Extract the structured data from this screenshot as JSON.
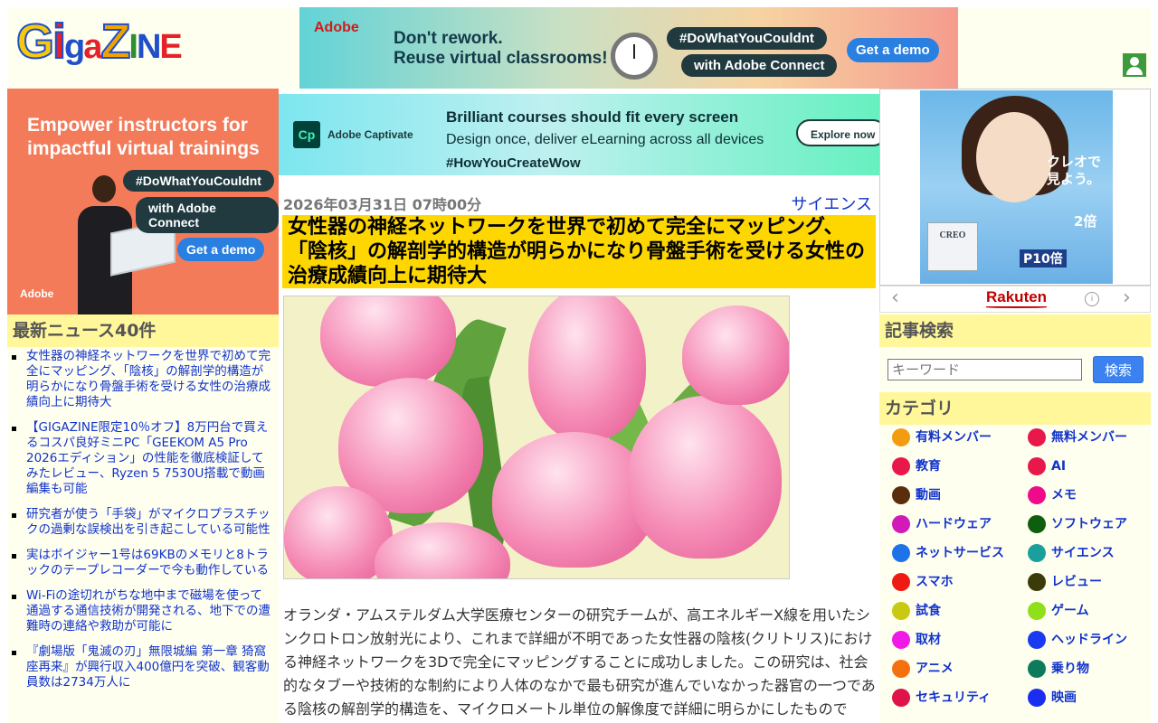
{
  "logo": {
    "letters": [
      "G",
      "i",
      "g",
      "a",
      "Z",
      "I",
      "N",
      "E"
    ],
    "colors": [
      "#f6c90e",
      "#e5222b",
      "#1f4fc9",
      "#e5222b",
      "#f0a300",
      "#2d8f2d",
      "#1f4fc9",
      "#e5222b"
    ]
  },
  "ads": {
    "top": {
      "brand": "Adobe",
      "headline_1": "Don't rework.",
      "headline_2": "Reuse virtual classrooms!",
      "pill_1": "#DoWhatYouCouldnt",
      "pill_2": "with Adobe Connect",
      "cta": "Get a demo"
    },
    "left": {
      "headline_1": "Empower instructors for",
      "headline_2": "impactful virtual trainings",
      "pill_1": "#DoWhatYouCouldnt",
      "pill_2": "with Adobe Connect",
      "cta": "Get a demo",
      "brand": "Adobe"
    },
    "mid": {
      "logo": "Cp",
      "brand": "Adobe Captivate",
      "headline": "Brilliant courses should fit every screen",
      "sub": "Design once, deliver eLearning across all devices",
      "hashtag": "#HowYouCreateWow",
      "cta": "Explore now"
    },
    "right": {
      "text_1": "クレオで",
      "text_2": "見よう。",
      "box": "CREO",
      "badge": "2倍",
      "p10": "P10倍",
      "brand": "Rakuten",
      "info": "i",
      "prev": "‹",
      "next": "›"
    }
  },
  "sidebar_left": {
    "news_title": "最新ニュース40件",
    "news": [
      "女性器の神経ネットワークを世界で初めて完全にマッピング、「陰核」の解剖学的構造が明らかになり骨盤手術を受ける女性の治療成績向上に期待大",
      "【GIGAZINE限定10％オフ】8万円台で買えるコスパ良好ミニPC「GEEKOM A5 Pro 2026エディション」の性能を徹底検証してみたレビュー、Ryzen 5 7530U搭載で動画編集も可能",
      "研究者が使う「手袋」がマイクロプラスチックの過剰な誤検出を引き起こしている可能性",
      "実はボイジャー1号は69KBのメモリと8トラックのテープレコーダーで今も動作している",
      "Wi-Fiの途切れがちな地中まで磁場を使って通過する通信技術が開発される、地下での遭難時の連絡や救助が可能に",
      "『劇場版「鬼滅の刃」無限城編 第一章 猗窩座再来』が興行収入400億円を突破、観客動員数は2734万人に"
    ]
  },
  "article": {
    "date": "2026年03月31日 07時00分",
    "category": "サイエンス",
    "title": "女性器の神経ネットワークを世界で初めて完全にマッピング、「陰核」の解剖学的構造が明らかになり骨盤手術を受ける女性の治療成績向上に期待大",
    "body": "オランダ・アムステルダム大学医療センターの研究チームが、高エネルギーX線を用いたシンクロトロン放射光により、これまで詳細が不明であった女性器の陰核(クリトリス)における神経ネットワークを3Dで完全にマッピングすることに成功しました。この研究は、社会的なタブーや技術的な制約により人体のなかで最も研究が進んでいなかった器官の一つである陰核の解剖学的構造を、マイクロメートル単位の解像度で詳細に明らかにしたもので"
  },
  "sidebar_right": {
    "search_title": "記事検索",
    "search_placeholder": "キーワード",
    "search_button": "検索",
    "category_title": "カテゴリ",
    "categories": [
      {
        "label": "有料メンバー",
        "color": "#f39c12"
      },
      {
        "label": "無料メンバー",
        "color": "#e8184a"
      },
      {
        "label": "教育",
        "color": "#e8184a"
      },
      {
        "label": "AI",
        "color": "#e8184a"
      },
      {
        "label": "動画",
        "color": "#5a2d0c"
      },
      {
        "label": "メモ",
        "color": "#ee0a8a"
      },
      {
        "label": "ハードウェア",
        "color": "#d21ab8"
      },
      {
        "label": "ソフトウェア",
        "color": "#0f5e0f"
      },
      {
        "label": "ネットサービス",
        "color": "#1e73e8"
      },
      {
        "label": "サイエンス",
        "color": "#1aa09c"
      },
      {
        "label": "スマホ",
        "color": "#ef1b12"
      },
      {
        "label": "レビュー",
        "color": "#3b3b0a"
      },
      {
        "label": "試食",
        "color": "#c9c912"
      },
      {
        "label": "ゲーム",
        "color": "#8fe01a"
      },
      {
        "label": "取材",
        "color": "#f01ae8"
      },
      {
        "label": "ヘッドライン",
        "color": "#1a3af0"
      },
      {
        "label": "アニメ",
        "color": "#f5700f"
      },
      {
        "label": "乗り物",
        "color": "#0d7a5a"
      },
      {
        "label": "セキュリティ",
        "color": "#e0124a"
      },
      {
        "label": "映画",
        "color": "#1a2ef0"
      }
    ]
  }
}
